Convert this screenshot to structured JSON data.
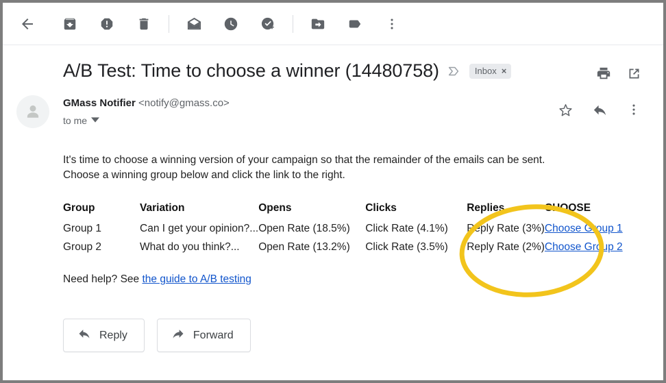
{
  "toolbar": {
    "items": [
      {
        "name": "back-icon",
        "label": "Back to Inbox"
      },
      {
        "name": "archive-icon",
        "label": "Archive"
      },
      {
        "name": "report-spam-icon",
        "label": "Report spam"
      },
      {
        "name": "delete-icon",
        "label": "Delete"
      },
      {
        "name": "mark-unread-icon",
        "label": "Mark as unread"
      },
      {
        "name": "snooze-icon",
        "label": "Snooze"
      },
      {
        "name": "add-to-tasks-icon",
        "label": "Add to Tasks"
      },
      {
        "name": "move-to-icon",
        "label": "Move to"
      },
      {
        "name": "labels-icon",
        "label": "Labels"
      },
      {
        "name": "more-options-icon",
        "label": "More"
      }
    ]
  },
  "email": {
    "subject": "A/B Test: Time to choose a winner (14480758)",
    "label_chip": "Inbox",
    "label_chip_remove": "×",
    "sender_name": "GMass Notifier",
    "sender_address": "<notify@gmass.co>",
    "recipient": "to me",
    "print_label": "Print all",
    "popout_label": "Open in new window",
    "star_label": "Not starred",
    "reply_label": "Reply",
    "more_label": "More"
  },
  "body": {
    "paragraph_line1": "It's time to choose a winning version of your campaign so that the remainder of the emails can be sent.",
    "paragraph_line2": "Choose a winning group below and click the link to the right.",
    "help_prefix": "Need help? See ",
    "help_link": "the guide to A/B testing"
  },
  "table": {
    "headers": [
      "Group",
      "Variation",
      "Opens",
      "Clicks",
      "Replies",
      "CHOOSE"
    ],
    "rows": [
      {
        "group": "Group 1",
        "variation": "Can I get your opinion?...",
        "opens": "Open Rate (18.5%)",
        "clicks": "Click Rate (4.1%)",
        "replies": "Reply Rate (3%)",
        "choose": "Choose Group 1"
      },
      {
        "group": "Group 2",
        "variation": "What do you think?...",
        "opens": "Open Rate (13.2%)",
        "clicks": "Click Rate (3.5%)",
        "replies": "Reply Rate (2%)",
        "choose": "Choose Group 2"
      }
    ]
  },
  "footer": {
    "reply_label": "Reply",
    "forward_label": "Forward"
  },
  "annotation": {
    "shape": "ellipse",
    "color": "#F2C41C",
    "target": "CHOOSE column"
  },
  "colors": {
    "link": "#1155cc",
    "icon_gray": "#5f6368",
    "text_primary": "#202124",
    "highlight": "#F2C41C",
    "frame_border": "#7d7d7d"
  }
}
